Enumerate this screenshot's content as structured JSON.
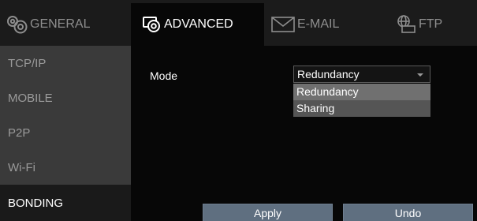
{
  "tabs": [
    {
      "label": "GENERAL",
      "icon": "gear-icon"
    },
    {
      "label": "ADVANCED",
      "icon": "gear-window-icon"
    },
    {
      "label": "E-MAIL",
      "icon": "envelope-icon"
    },
    {
      "label": "FTP",
      "icon": "globe-folder-icon"
    }
  ],
  "active_tab": "ADVANCED",
  "sidebar": {
    "items": [
      "TCP/IP",
      "MOBILE",
      "P2P",
      "Wi-Fi",
      "BONDING"
    ],
    "active": "BONDING"
  },
  "form": {
    "mode_label": "Mode",
    "mode_value": "Redundancy",
    "options": [
      "Redundancy",
      "Sharing"
    ],
    "highlighted_option": "Redundancy"
  },
  "buttons": {
    "apply": "Apply",
    "undo": "Undo"
  },
  "colors": {
    "tabbar_bg": "#1b1b1b",
    "active_tab_bg": "#070707",
    "sidebar_bg": "#3a3a3a",
    "sidebar_active_bg": "#1a1a1a",
    "panel_bg": "#070707",
    "button_bg": "#5f6f80",
    "dropdown_bg": "#555555",
    "dropdown_highlight": "#707070"
  }
}
